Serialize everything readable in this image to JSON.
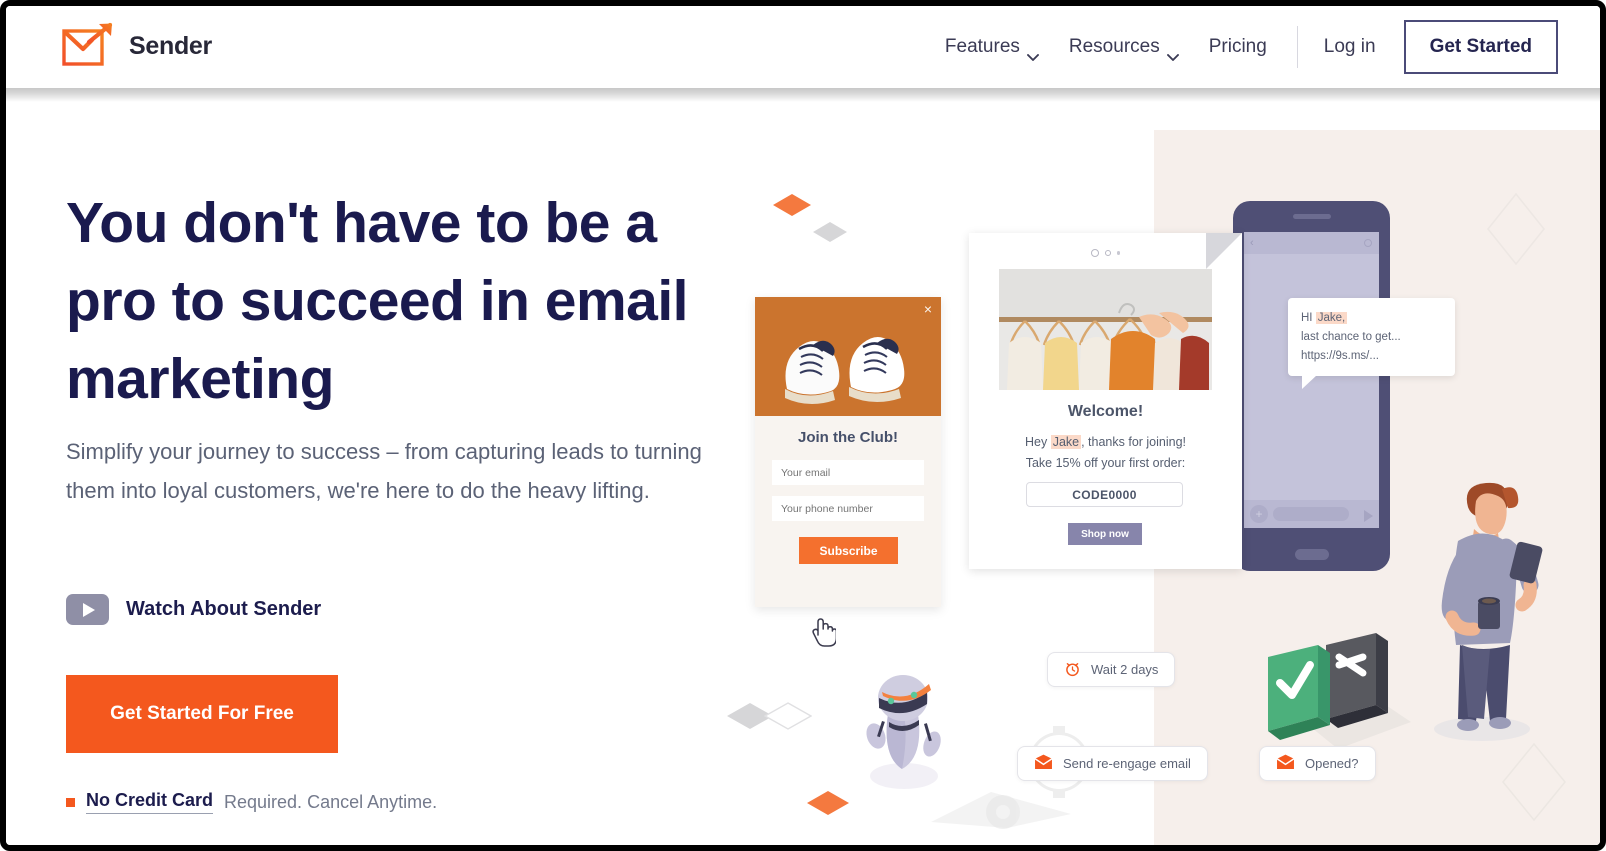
{
  "header": {
    "logo_text": "Sender",
    "logo_icon": "envelope-check-arrow-icon",
    "nav": [
      {
        "label": "Features",
        "has_dropdown": true,
        "icon": "chevron-down-icon"
      },
      {
        "label": "Resources",
        "has_dropdown": true,
        "icon": "chevron-down-icon"
      },
      {
        "label": "Pricing",
        "has_dropdown": false
      }
    ],
    "login_label": "Log in",
    "get_started_label": "Get Started"
  },
  "hero": {
    "headline": "You don't have to be a pro to succeed in email marketing",
    "subhead": "Simplify your journey to success – from capturing leads to turning them into loyal customers, we're here to do the heavy lifting.",
    "watch_label": "Watch About Sender",
    "watch_icon": "play-icon",
    "cta_label": "Get Started For Free",
    "credit_strong": "No Credit Card",
    "credit_rest": " Required. Cancel Anytime.",
    "bullet_icon": "square-bullet-icon"
  },
  "illustration": {
    "popup": {
      "title": "Join the Club!",
      "close_icon": "close-icon",
      "email_placeholder": "Your email",
      "phone_placeholder": "Your phone number",
      "subscribe_label": "Subscribe",
      "image_alt": "white-sneakers-photo",
      "cursor_icon": "pointing-hand-cursor"
    },
    "email_card": {
      "dots_icon": "carousel-dots-icon",
      "image_alt": "clothes-rack-photo",
      "heading": "Welcome!",
      "line1_pre": "Hey ",
      "line1_name": "Jake",
      "line1_post": ", thanks for joining!",
      "line2": "Take 15% off your first order:",
      "code": "CODE0000",
      "shop_label": "Shop now"
    },
    "sms": {
      "line1_pre": "HI ",
      "line1_name": "Jake,",
      "line2": "last chance to get...",
      "line3": "https://9s.ms/...",
      "device_icon": "smartphone-icon"
    },
    "chips": [
      {
        "label": "Wait 2 days",
        "icon": "alarm-clock-icon"
      },
      {
        "label": "Send re-engage email",
        "icon": "envelope-icon"
      },
      {
        "label": "Opened?",
        "icon": "envelope-icon"
      }
    ],
    "iso_cards": [
      {
        "name": "approved-card",
        "icon": "check-icon",
        "color": "#4caf7d"
      },
      {
        "name": "rejected-card",
        "icon": "x-icon",
        "color": "#5f6068"
      }
    ],
    "robot_icon": "robot-icon",
    "gear_icon": "gear-icon",
    "person_icon": "person-with-phone-illustration",
    "diamonds": [
      "orange-diamond",
      "grey-diamond",
      "white-outline-diamond",
      "orange-diamond",
      "grey-diamond"
    ]
  },
  "colors": {
    "brand_orange": "#f4581e",
    "navy": "#1a1a4e",
    "body_grey": "#5b6276",
    "beige_panel": "#f6efeb",
    "purple_device": "#4f4f75",
    "green": "#4caf7d"
  }
}
